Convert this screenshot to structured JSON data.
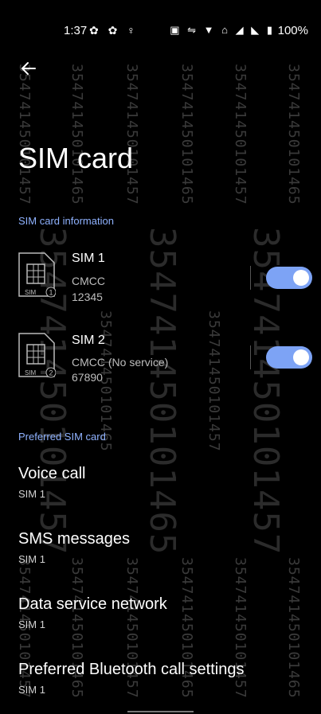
{
  "status": {
    "time": "1:37",
    "battery": "100%",
    "left_icons": "✿ ✿ ♀",
    "right_icons": "▣ ⇋ ▼ ⌂ ◢ ◣ ▮"
  },
  "page": {
    "title": "SIM card"
  },
  "sections": {
    "info": "SIM card information",
    "preferred": "Preferred SIM card"
  },
  "sims": [
    {
      "name": "SIM 1",
      "carrier": "CMCC",
      "number": "12345",
      "slot": "1",
      "enabled": true
    },
    {
      "name": "SIM 2",
      "carrier": "CMCC (No service)",
      "number": "67890",
      "slot": "2",
      "enabled": true
    }
  ],
  "preferred": [
    {
      "label": "Voice call",
      "value": "SIM 1"
    },
    {
      "label": "SMS messages",
      "value": "SIM 1"
    },
    {
      "label": "Data service network",
      "value": "SIM 1"
    },
    {
      "label": "Preferred Bluetooth call settings",
      "value": "SIM 1"
    }
  ],
  "watermark": {
    "a": "354741450101457",
    "b": "354741450101465",
    "c": "354741450101457",
    "d": "354741450101465",
    "e": "354741450101457",
    "f": "354741450101465"
  },
  "icons": {
    "back": "arrow-left-icon",
    "sim": "sim-card-icon"
  },
  "colors": {
    "accent": "#7da3f5",
    "section": "#8fb2ff",
    "background": "#000000"
  }
}
